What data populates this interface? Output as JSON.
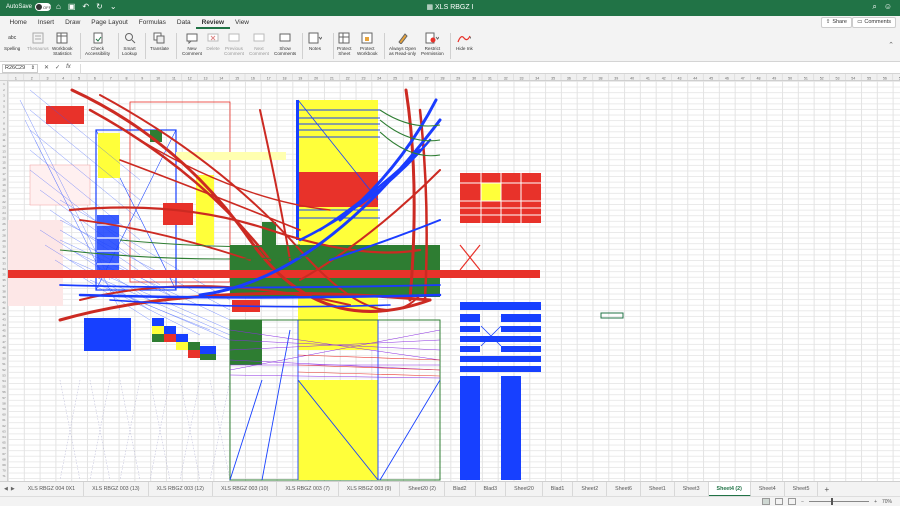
{
  "titlebar": {
    "autosave_label": "AutoSave",
    "autosave_state": "OFF",
    "title": "XLS RBGZ I",
    "bg": "#217346"
  },
  "tabs": [
    "Home",
    "Insert",
    "Draw",
    "Page Layout",
    "Formulas",
    "Data",
    "Review",
    "View"
  ],
  "active_tab": "Review",
  "share_label": "Share",
  "comments_label": "Comments",
  "ribbon": {
    "spelling": [
      "Spelling"
    ],
    "thesaurus": [
      "Thesaurus"
    ],
    "workbook_stats": [
      "Workbook",
      "Statistics"
    ],
    "check_accessibility": [
      "Check",
      "Accessibility"
    ],
    "smart_lookup": [
      "Smart",
      "Lookup"
    ],
    "translate": [
      "Translate"
    ],
    "new_comment": [
      "New",
      "Comment"
    ],
    "delete": [
      "Delete"
    ],
    "previous_comment": [
      "Previous",
      "Comment"
    ],
    "next_comment": [
      "Next",
      "Comment"
    ],
    "show_comments": [
      "Show",
      "Comments"
    ],
    "notes": [
      "Notes"
    ],
    "protect_sheet": [
      "Protect",
      "Sheet"
    ],
    "protect_workbook": [
      "Protect",
      "Workbook"
    ],
    "always_open_readonly": [
      "Always Open",
      "as Read-only"
    ],
    "restrict_permission": [
      "Restrict",
      "Permission"
    ],
    "hide_ink": [
      "Hide Ink"
    ],
    "spelling_icon_text": "abc"
  },
  "formula_bar": {
    "name_box": "R26C29",
    "fx_label": "fx",
    "value": ""
  },
  "column_headers": [
    "1",
    "2",
    "3",
    "4",
    "5",
    "6",
    "7",
    "8",
    "9",
    "10",
    "11",
    "12",
    "13",
    "14",
    "15",
    "16",
    "17",
    "18",
    "19",
    "20",
    "21",
    "22",
    "23",
    "24",
    "25",
    "26",
    "27",
    "28",
    "29",
    "30",
    "31",
    "32",
    "33",
    "34",
    "35",
    "36",
    "37",
    "38",
    "39",
    "40",
    "41",
    "42",
    "43",
    "44",
    "45",
    "46",
    "47",
    "48",
    "49",
    "50",
    "51",
    "52",
    "53",
    "54",
    "55",
    "56",
    "57"
  ],
  "sheets": [
    "XLS RBGZ 004 0X1",
    "XLS RBGZ 003 (13)",
    "XLS RBGZ 003 (12)",
    "XLS RBGZ 003 (10)",
    "XLS RBGZ 003 (7)",
    "XLS RBGZ 003 (9)",
    "Sheet20 (2)",
    "Blad2",
    "Blad3",
    "Sheet20",
    "Blad1",
    "Sheet2",
    "Sheet6",
    "Sheet1",
    "Sheet3",
    "Sheet4 (2)",
    "Sheet4",
    "Sheet5"
  ],
  "active_sheet": "Sheet4 (2)",
  "status": {
    "zoom": "70%"
  },
  "colors": {
    "accent": "#217346",
    "red": "#e8322a",
    "blue": "#1740ff",
    "yellow": "#ffff3a",
    "green": "#2e7d32"
  }
}
